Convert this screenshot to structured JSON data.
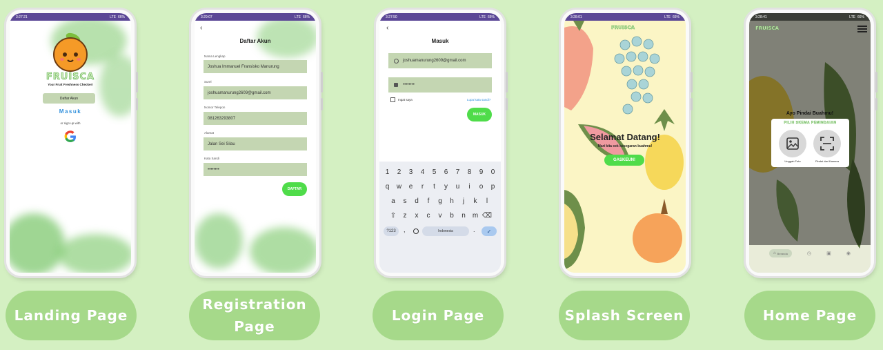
{
  "status": {
    "landing_time": "3:27:21",
    "register_time": "3:29:07",
    "login_time": "3:27:50",
    "splash_time": "3:28:01",
    "home_time": "3:28:41",
    "network": "LTE",
    "battery": "66%"
  },
  "captions": [
    "Landing Page",
    "Registration Page",
    "Login Page",
    "Splash Screen",
    "Home Page"
  ],
  "landing": {
    "brand": "FRUISCA",
    "tagline": "Your Fruit Freshness Checker!",
    "register_button": "Daftar Akun",
    "login_link": "Masuk",
    "signup_with": "or sign up with",
    "google_icon": "google-icon"
  },
  "register": {
    "title": "Daftar Akun",
    "fields": [
      {
        "label": "Nama Lengkap",
        "value": "Joshua Immanuel Fransisko Manurung"
      },
      {
        "label": "Surel",
        "value": "joshuamanurung2609@gmail.com"
      },
      {
        "label": "Nomor Telepon",
        "value": "081263293807"
      },
      {
        "label": "Alamat",
        "value": "Jalan Sei Silau"
      },
      {
        "label": "Kata Sandi",
        "value": "••••••••"
      }
    ],
    "submit": "DAFTAR"
  },
  "login": {
    "title": "Masuk",
    "email": "joshuamanurung2609@gmail.com",
    "password": "••••••••",
    "remember": "Ingat saya",
    "forgot": "Lupa kata sandi?",
    "submit": "MASUK",
    "keyboard": {
      "row1": [
        "1",
        "2",
        "3",
        "4",
        "5",
        "6",
        "7",
        "8",
        "9",
        "0"
      ],
      "row2": [
        "q",
        "w",
        "e",
        "r",
        "t",
        "y",
        "u",
        "i",
        "o",
        "p"
      ],
      "row3": [
        "a",
        "s",
        "d",
        "f",
        "g",
        "h",
        "j",
        "k",
        "l"
      ],
      "row4": [
        "z",
        "x",
        "c",
        "v",
        "b",
        "n",
        "m"
      ],
      "symbols": "?123",
      "comma": ",",
      "space": "Indonesia",
      "period": "."
    }
  },
  "splash": {
    "brand": "FRUISCA",
    "title": "Selamat Datang!",
    "subtitle": "Mari kita cek kesegaran buahmu!",
    "button": "GASKEUN!"
  },
  "home": {
    "brand": "FRUISCA",
    "prompt": "Ayo Pindai Buahmu!",
    "dialog_title": "PILIH SKEMA PEMINDAIAN",
    "upload": "Unggah Foto",
    "camera": "Pindai dari Kamera",
    "nav_home": "Beranda"
  },
  "colors": {
    "background": "#d4f0c2",
    "caption": "#a6d98a",
    "accent_green": "#4fdc4a",
    "field": "#c4d6b2",
    "status_bar": "#5b4796"
  }
}
